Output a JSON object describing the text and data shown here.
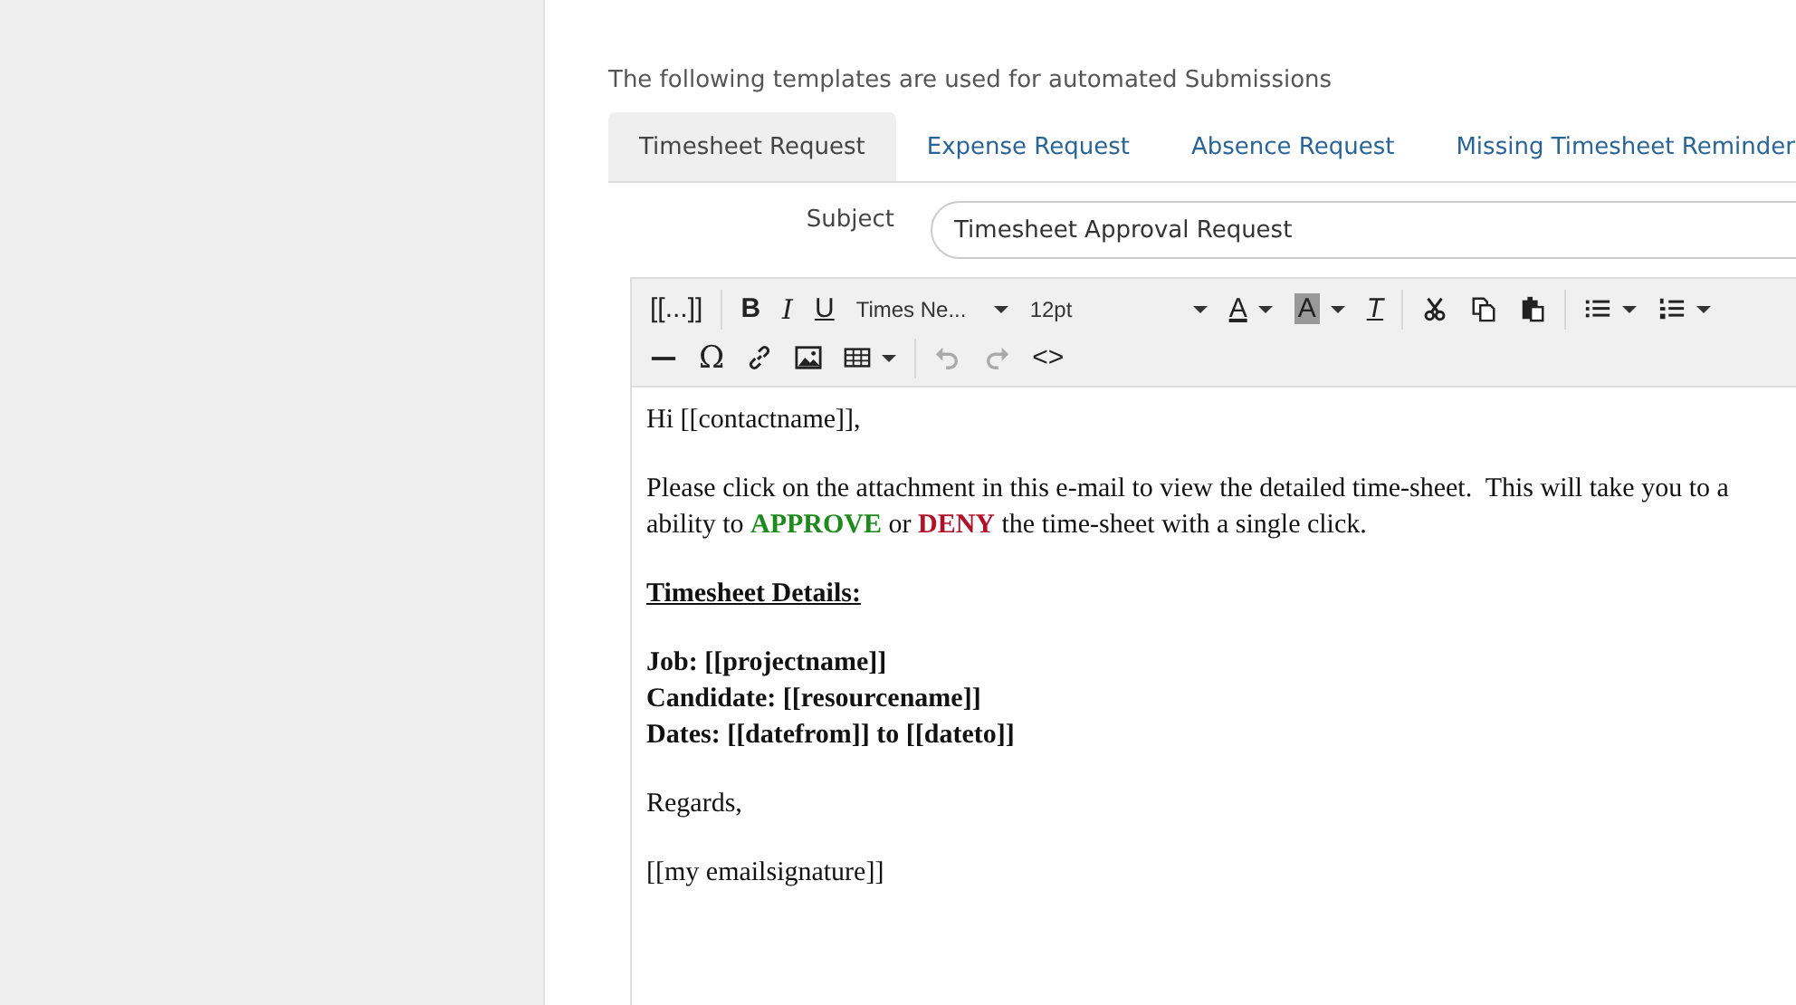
{
  "intro": "The following templates are used for automated Submissions",
  "tabs": [
    {
      "label": "Timesheet Request",
      "selected": true
    },
    {
      "label": "Expense Request",
      "selected": false
    },
    {
      "label": "Absence Request",
      "selected": false
    },
    {
      "label": "Missing Timesheet Reminder",
      "selected": false
    }
  ],
  "subject": {
    "label": "Subject",
    "value": "Timesheet Approval Request"
  },
  "toolbar": {
    "rows": [
      {
        "groups": [
          {
            "items": [
              {
                "kind": "template",
                "label": "[[...]]",
                "disabled": false
              }
            ]
          },
          {
            "items": [
              {
                "kind": "bold",
                "label": "B",
                "disabled": false
              },
              {
                "kind": "italic",
                "label": "I",
                "disabled": false
              },
              {
                "kind": "underline",
                "label": "U",
                "disabled": false
              },
              {
                "kind": "select",
                "label": "Times Ne...",
                "disabled": false
              },
              {
                "kind": "select",
                "label": "12pt",
                "disabled": false
              },
              {
                "kind": "forecolor",
                "label": "A",
                "disabled": false
              },
              {
                "kind": "backcolor",
                "label": "A",
                "disabled": false
              },
              {
                "kind": "clearformat",
                "label": "T",
                "disabled": false
              }
            ]
          },
          {
            "items": [
              {
                "kind": "cut",
                "disabled": false
              },
              {
                "kind": "copy",
                "disabled": false
              },
              {
                "kind": "paste",
                "disabled": false
              }
            ]
          },
          {
            "items": [
              {
                "kind": "bullets",
                "disabled": false
              },
              {
                "kind": "numbers",
                "disabled": false
              }
            ]
          }
        ]
      },
      {
        "groups": [
          {
            "items": [
              {
                "kind": "hr",
                "disabled": false
              },
              {
                "kind": "omega",
                "label": "Ω",
                "disabled": false
              },
              {
                "kind": "link",
                "disabled": false
              },
              {
                "kind": "image",
                "disabled": false
              },
              {
                "kind": "table",
                "disabled": false
              }
            ]
          },
          {
            "items": [
              {
                "kind": "undo",
                "disabled": true
              },
              {
                "kind": "redo",
                "disabled": true
              },
              {
                "kind": "code",
                "label": "<>",
                "disabled": false
              }
            ]
          }
        ]
      }
    ]
  },
  "body": [
    {
      "kind": "plain",
      "lines": [
        [
          {
            "text": "Hi [[contactname]],"
          }
        ]
      ]
    },
    {
      "kind": "plain",
      "lines": [
        [
          {
            "text": "Please click on the attachment in this e-mail to view the detailed time-sheet.  This will take you to a"
          }
        ],
        [
          {
            "text": "ability to "
          },
          {
            "text": "APPROVE",
            "color": "#1e8a1e"
          },
          {
            "text": " or "
          },
          {
            "text": "DENY",
            "color": "#b0102a"
          },
          {
            "text": " the time-sheet with a single click."
          }
        ]
      ]
    },
    {
      "kind": "heading",
      "lines": [
        [
          {
            "text": "Timesheet Details:"
          }
        ]
      ]
    },
    {
      "kind": "bold",
      "lines": [
        [
          {
            "text": "Job: [[projectname]]"
          }
        ],
        [
          {
            "text": "Candidate: [[resourcename]]"
          }
        ],
        [
          {
            "text": "Dates: [[datefrom]] to [[dateto]]"
          }
        ]
      ]
    },
    {
      "kind": "plain",
      "lines": [
        [
          {
            "text": "Regards,"
          }
        ]
      ]
    },
    {
      "kind": "plain",
      "lines": [
        [
          {
            "text": "[[my emailsignature]]"
          }
        ]
      ]
    }
  ]
}
